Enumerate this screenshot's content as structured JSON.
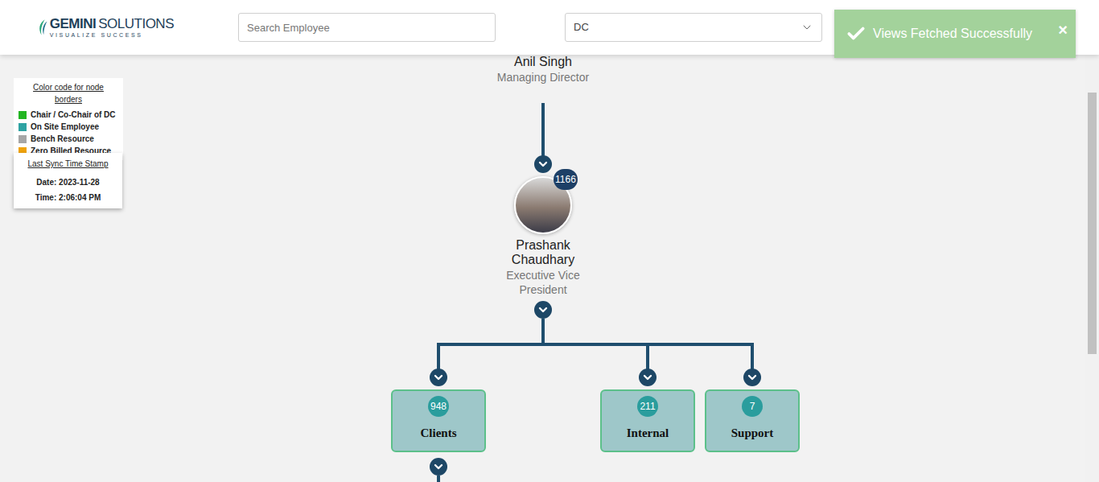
{
  "header": {
    "logo": {
      "brand": "GEMINI",
      "brand2": "SOLUTIONS",
      "tagline": "VISUALIZE SUCCESS"
    },
    "search": {
      "placeholder": "Search Employee"
    },
    "view_select": {
      "value": "DC"
    }
  },
  "toast": {
    "message": "Views Fetched Successfully",
    "close": "×"
  },
  "legend": {
    "title": "Color code for node borders",
    "items": [
      {
        "label": "Chair / Co-Chair of DC",
        "color": "#22b522"
      },
      {
        "label": "On Site Employee",
        "color": "#2ea3a3"
      },
      {
        "label": "Bench Resource",
        "color": "#a6a6a6"
      },
      {
        "label": "Zero Billed Resource",
        "color": "#f0a30a"
      }
    ]
  },
  "sync": {
    "title": "Last Sync Time Stamp",
    "date": "Date: 2023-11-28",
    "time": "Time: 2:06:04 PM"
  },
  "tree": {
    "root": {
      "name": "Anil Singh",
      "title": "Managing Director"
    },
    "person": {
      "name": "Prashank Chaudhary",
      "title": "Executive Vice President",
      "count": "1166",
      "expanded": true
    },
    "groups": [
      {
        "label": "Clients",
        "count": "948",
        "expanded": true
      },
      {
        "label": "Internal",
        "count": "211",
        "expanded": false
      },
      {
        "label": "Support",
        "count": "7",
        "expanded": false
      }
    ]
  }
}
